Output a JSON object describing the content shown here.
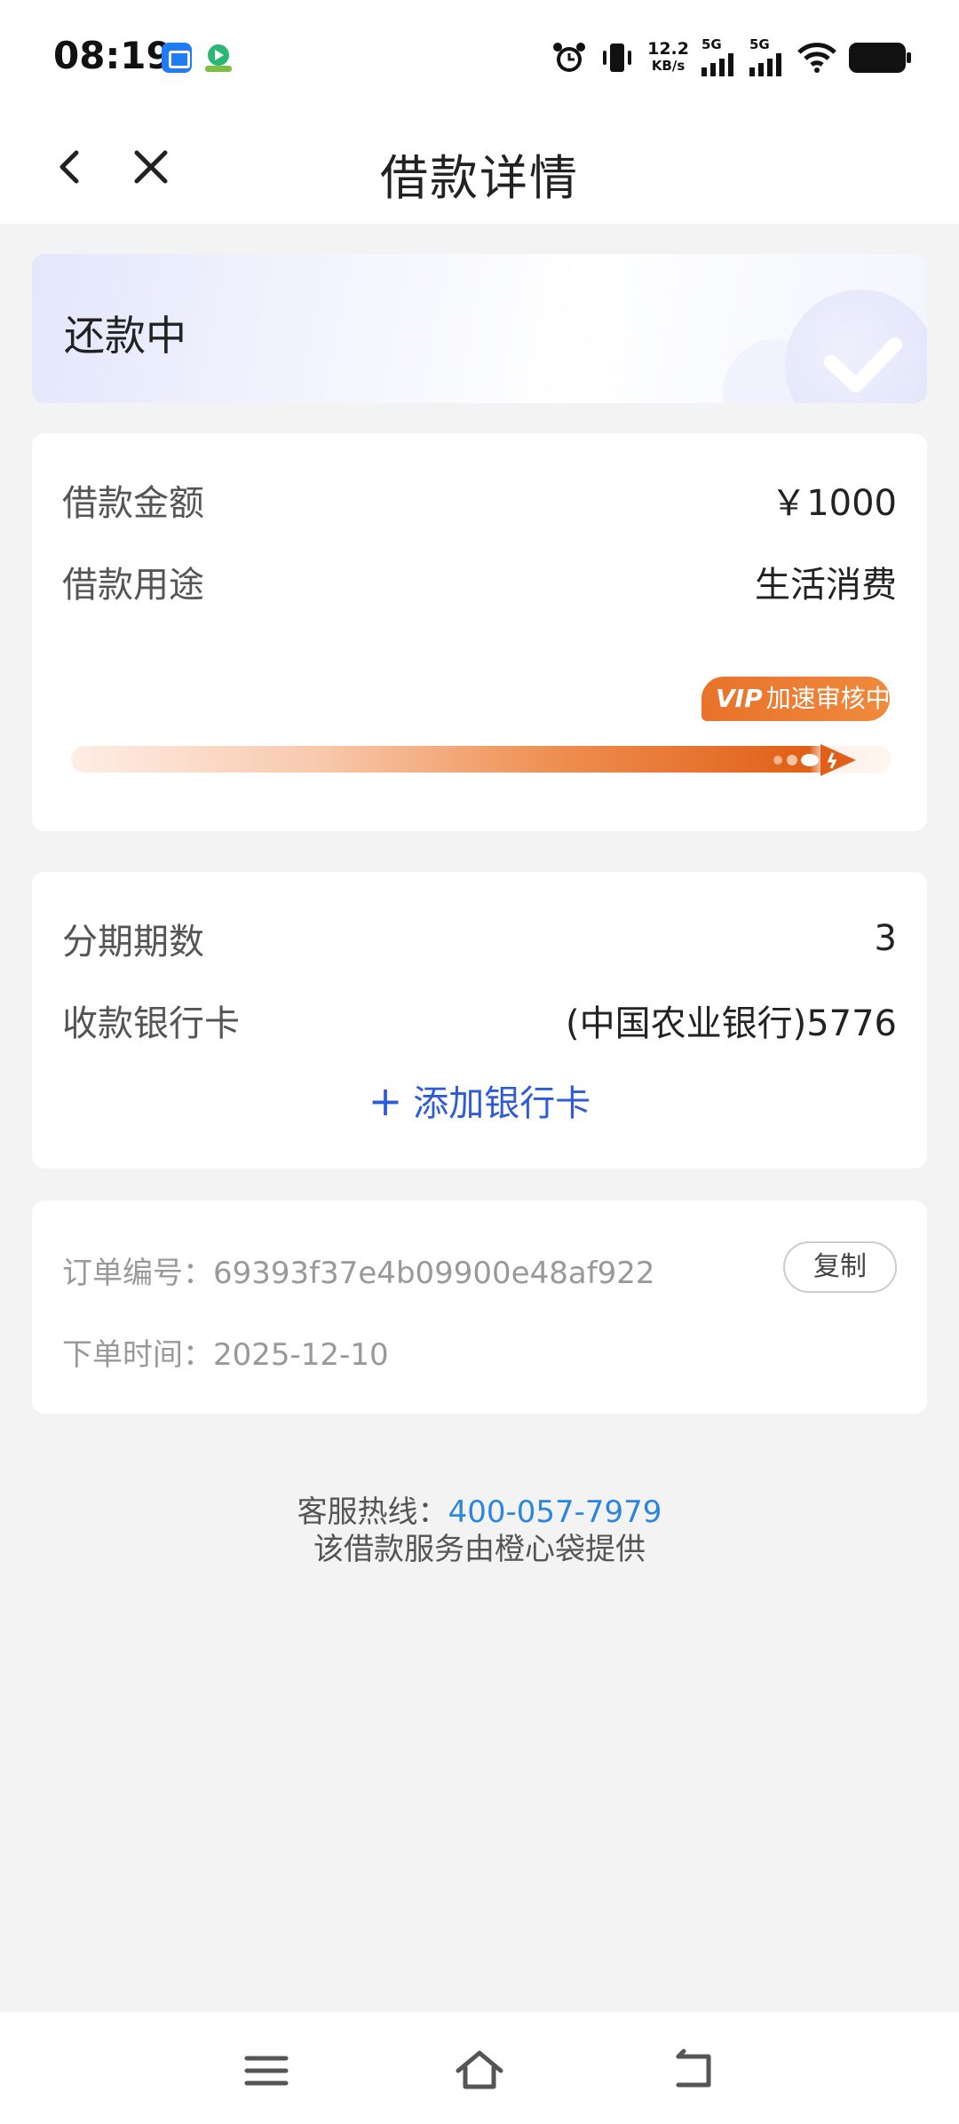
{
  "status_bar": {
    "time": "08:19",
    "net_speed": "12.2",
    "net_unit": "KB/s",
    "signal1_label": "5G",
    "signal2_label": "5G",
    "icons": [
      "app-notification-icon",
      "app-video-icon",
      "alarm-icon",
      "vibrate-icon",
      "signal-icon",
      "signal-icon",
      "wifi-icon",
      "battery-icon"
    ]
  },
  "header": {
    "title": "借款详情"
  },
  "status_card": {
    "status": "还款中"
  },
  "loan_card": {
    "amount_label": "借款金额",
    "amount_value": "￥1000",
    "purpose_label": "借款用途",
    "purpose_value": "生活消费",
    "vip_tag_vip": "VIP",
    "vip_tag_text": "加速审核中"
  },
  "installment_card": {
    "periods_label": "分期期数",
    "periods_value": "3",
    "bank_label": "收款银行卡",
    "bank_value": "(中国农业银行)5776",
    "add_bank_label": "添加银行卡"
  },
  "order_card": {
    "order_no_label": "订单编号：",
    "order_no_value": "69393f37e4b09900e48af922",
    "copy_label": "复制",
    "order_time_label": "下单时间：",
    "order_time_value": "2025-12-10"
  },
  "footer": {
    "hotline_label": "客服热线：",
    "hotline_value": "400-057-7979",
    "provider_text": "该借款服务由橙心袋提供"
  },
  "colors": {
    "accent_blue": "#2f5bd8",
    "link_blue": "#2a86e0",
    "vip_orange": "#e8722a",
    "background": "#f3f3f3"
  }
}
